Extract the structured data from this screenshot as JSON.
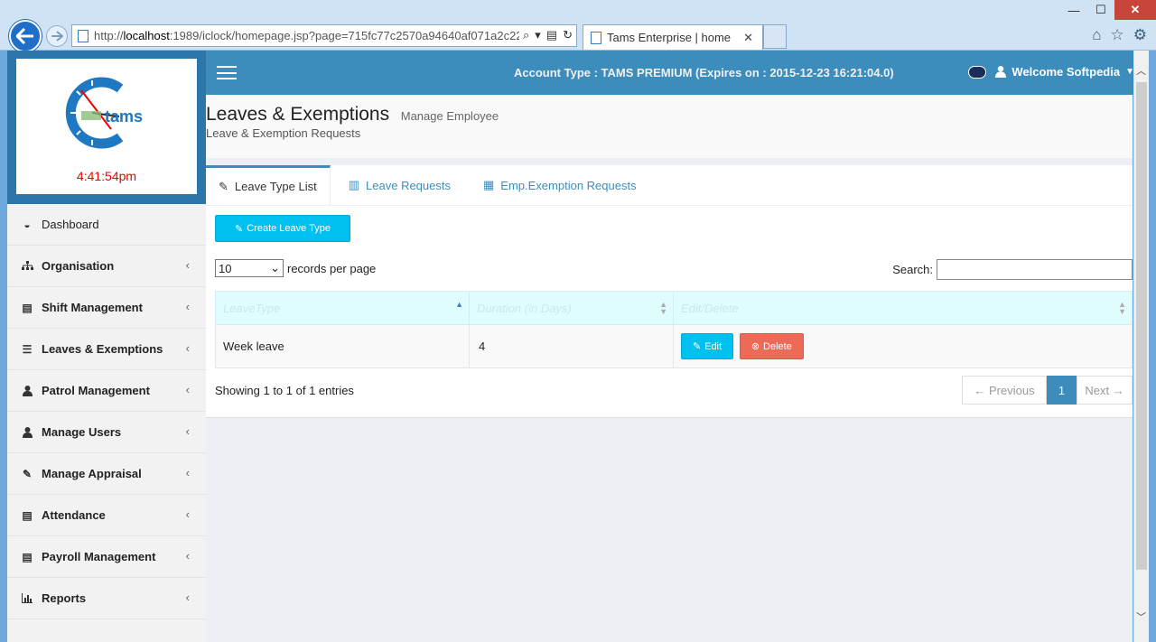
{
  "browser": {
    "url_prefix": "http://",
    "url_host": "localhost",
    "url_rest": ":1989/iclock/homepage.jsp?page=715fc77c2570a94640af071a2c22a61f&s",
    "tab_title": "Tams Enterprise | home"
  },
  "sidebar": {
    "logo_text": "tams",
    "clock_time": "4:41:54pm",
    "items": [
      {
        "label": "Dashboard",
        "icon": "dashboard-icon"
      },
      {
        "label": "Organisation",
        "icon": "sitemap-icon"
      },
      {
        "label": "Shift Management",
        "icon": "list-icon"
      },
      {
        "label": "Leaves & Exemptions",
        "icon": "bars-icon"
      },
      {
        "label": "Patrol Management",
        "icon": "user-icon"
      },
      {
        "label": "Manage Users",
        "icon": "user-icon"
      },
      {
        "label": "Manage Appraisal",
        "icon": "edit-icon"
      },
      {
        "label": "Attendance",
        "icon": "list-icon"
      },
      {
        "label": "Payroll Management",
        "icon": "list-icon"
      },
      {
        "label": "Reports",
        "icon": "bar-chart-icon"
      }
    ]
  },
  "topbar": {
    "account_text": "Account Type : TAMS PREMIUM (Expires on : 2015-12-23 16:21:04.0)",
    "welcome": "Welcome Softpedia"
  },
  "page": {
    "title": "Leaves & Exemptions",
    "subtitle": "Manage Employee",
    "breadcrumb": "Leave & Exemption Requests"
  },
  "tabs": [
    {
      "label": "Leave Type List",
      "active": true
    },
    {
      "label": "Leave Requests",
      "active": false
    },
    {
      "label": "Emp.Exemption Requests",
      "active": false
    }
  ],
  "toolbar": {
    "create_label": "Create Leave Type",
    "length_value": "10",
    "length_suffix": "records per page",
    "search_label": "Search:"
  },
  "table": {
    "columns": [
      "LeaveType",
      "Duration (in Days)",
      "Edit/Delete"
    ],
    "rows": [
      {
        "leave_type": "Week leave",
        "duration": "4",
        "edit_label": "Edit",
        "delete_label": "Delete"
      }
    ]
  },
  "footer": {
    "info": "Showing 1 to 1 of 1 entries",
    "prev": "← Previous",
    "page": "1",
    "next": "Next →"
  },
  "colors": {
    "primary": "#3c8dbc",
    "info": "#00c0ef",
    "danger": "#ed6a58",
    "clock": "#ee0000"
  }
}
